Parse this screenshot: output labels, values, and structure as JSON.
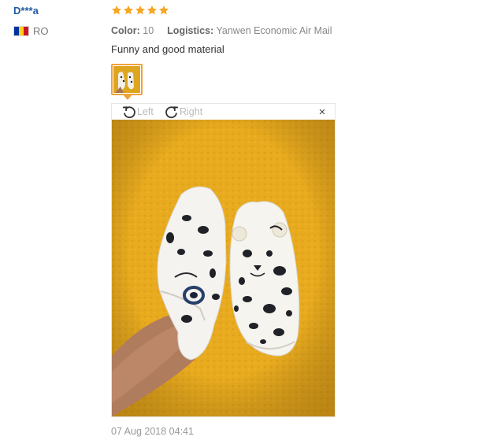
{
  "reviewer": {
    "name": "D***a",
    "country_code": "RO",
    "flag_colors": [
      "#0033a0",
      "#fcd116",
      "#ce1126"
    ]
  },
  "review": {
    "rating": 5,
    "rating_max": 5,
    "star_color": "#f5a623",
    "color_label": "Color:",
    "color_value": "10",
    "logistics_label": "Logistics:",
    "logistics_value": "Yanwen Economic Air Mail",
    "text": "Funny and good material",
    "date": "07 Aug 2018 04:41"
  },
  "viewer": {
    "rotate_left_label": "Left",
    "rotate_right_label": "Right",
    "close_symbol": "×",
    "rotate_left_icon": "rotate-left-icon",
    "rotate_right_icon": "rotate-right-icon",
    "close_icon": "close-icon"
  },
  "colors": {
    "accent_border": "#f0a23a",
    "name_blue": "#1f5aa5"
  }
}
